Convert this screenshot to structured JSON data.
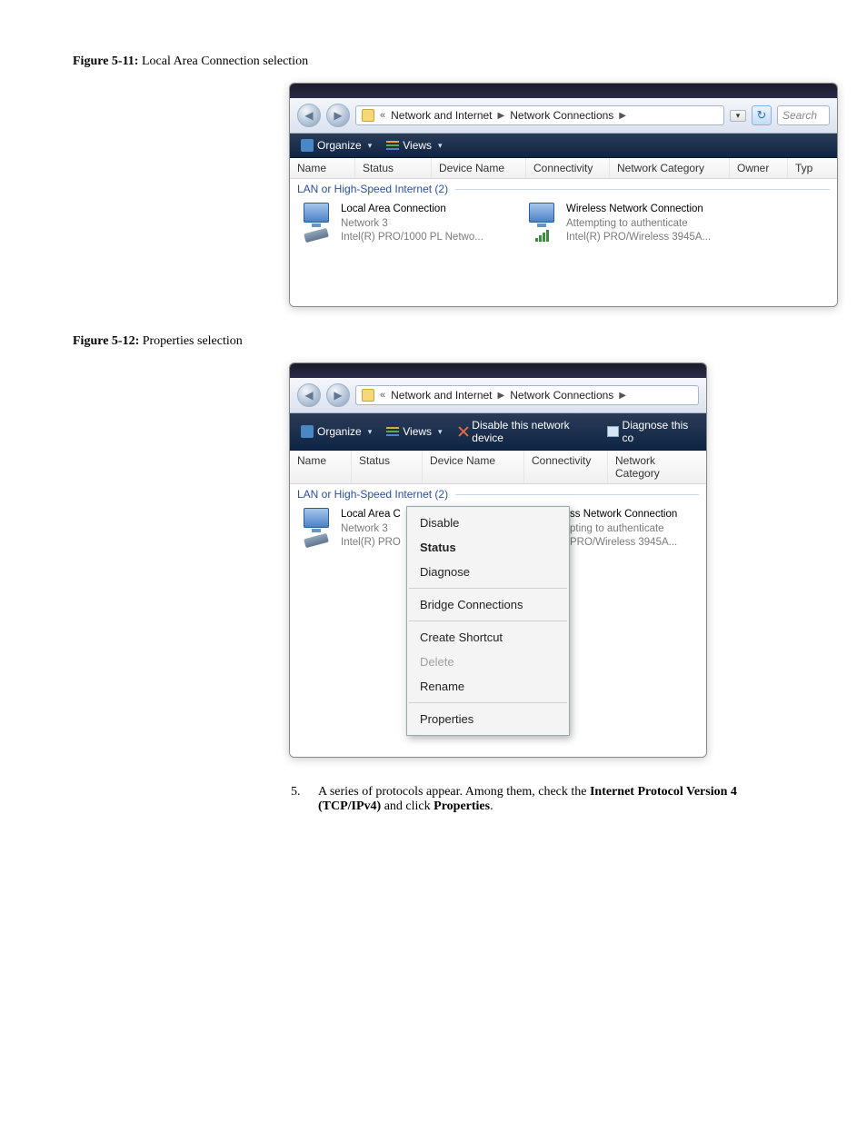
{
  "fig1": {
    "label": "Figure 5-11:",
    "caption": "Local Area Connection selection"
  },
  "fig2": {
    "label": "Figure 5-12:",
    "caption": "Properties selection"
  },
  "breadcrumb": {
    "chevrons": "«",
    "item1": "Network and Internet",
    "item2": "Network Connections",
    "search_placeholder": "Search"
  },
  "cmdbar": {
    "organize": "Organize",
    "views": "Views",
    "disable": "Disable this network device",
    "diagnose": "Diagnose this co"
  },
  "columns": {
    "name": "Name",
    "status": "Status",
    "device": "Device Name",
    "connectivity": "Connectivity",
    "category": "Network Category",
    "owner": "Owner",
    "type": "Typ"
  },
  "group_header": "LAN or High-Speed Internet (2)",
  "conn_lan": {
    "name": "Local Area Connection",
    "status": "Network 3",
    "device": "Intel(R) PRO/1000 PL Netwo..."
  },
  "conn_wifi": {
    "name": "Wireless Network Connection",
    "status": "Attempting to authenticate",
    "device": "Intel(R) PRO/Wireless 3945A..."
  },
  "conn_lan2": {
    "name": "Local Area C",
    "status": "Network 3",
    "device": "Intel(R) PRO"
  },
  "conn_wifi2": {
    "name_part": "ss Network Connection",
    "status_part": "pting to authenticate",
    "device_part": "PRO/Wireless 3945A..."
  },
  "context_menu": {
    "disable": "Disable",
    "status": "Status",
    "diagnose": "Diagnose",
    "bridge": "Bridge Connections",
    "shortcut": "Create Shortcut",
    "delete": "Delete",
    "rename": "Rename",
    "properties": "Properties"
  },
  "step5": {
    "num": "5.",
    "text_a": "A series of protocols appear. Among them, check the ",
    "text_b": "Internet Protocol Version 4 (TCP/IPv4)",
    "text_c": " and click ",
    "text_d": "Properties",
    "text_e": "."
  }
}
